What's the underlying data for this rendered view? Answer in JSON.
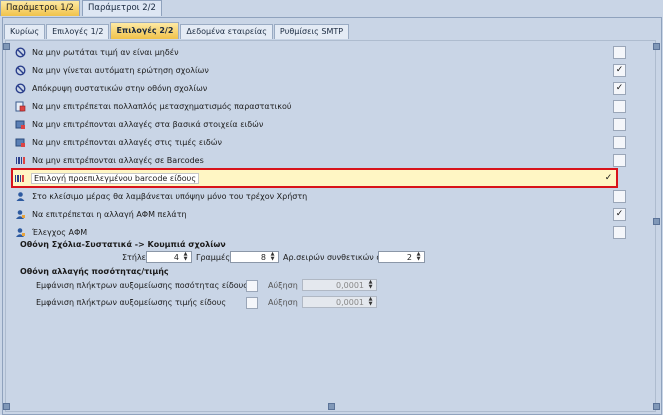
{
  "top_tabs": [
    "Παράμετροι 1/2",
    "Παράμετροι 2/2"
  ],
  "sub_tabs": [
    "Κυρίως",
    "Επιλογές 1/2",
    "Επιλογές 2/2",
    "Δεδομένα εταιρείας",
    "Ρυθμίσεις SMTP"
  ],
  "options": [
    {
      "label": "Να μην ρωτάται τιμή αν είναι μηδέν",
      "icon": "no-entry-icon",
      "checked": false
    },
    {
      "label": "Να μην γίνεται αυτόματη ερώτηση σχολίων",
      "icon": "no-entry-icon",
      "checked": true
    },
    {
      "label": "Απόκρυψη συστατικών στην οθόνη σχολίων",
      "icon": "no-entry-icon",
      "checked": true
    },
    {
      "label": "Να μην επιτρέπεται πολλαπλός μετασχηματισμός παραστατικού",
      "icon": "document-icon",
      "checked": false
    },
    {
      "label": "Να μην επιτρέπονται αλλαγές στα βασικά στοιχεία ειδών",
      "icon": "item-edit-icon",
      "checked": false
    },
    {
      "label": "Να μην επιτρέπονται αλλαγές στις τιμές ειδών",
      "icon": "item-edit-icon",
      "checked": false
    },
    {
      "label": "Να μην επιτρέπονται αλλαγές σε Barcodes",
      "icon": "barcode-icon",
      "checked": false
    },
    {
      "label": "Επιλογή προεπιλεγμένου barcode είδους",
      "icon": "barcode-icon",
      "checked": true
    },
    {
      "label": "Στο κλείσιμο μέρας θα λαμβάνεται υπόψην μόνο του τρέχον Χρήστη",
      "icon": "user-icon",
      "checked": false
    },
    {
      "label": "Να επιτρέπεται η αλλαγή ΑΦΜ πελάτη",
      "icon": "user-edit-icon",
      "checked": true
    },
    {
      "label": "Έλεγχος ΑΦΜ",
      "icon": "user-edit-icon",
      "checked": false
    }
  ],
  "comments_section": {
    "title": "Οθόνη Σχόλια-Συστατικά -> Κουμπιά σχολίων",
    "columns_label": "Στήλες",
    "columns_value": "4",
    "rows_label": "Γραμμές",
    "rows_value": "8",
    "component_rows_label": "Αρ.σειρών συνθετικών σχολίων",
    "component_rows_value": "2"
  },
  "quantity_section": {
    "title": "Οθόνη αλλαγής ποσότητας/τιμής",
    "qty_buttons_label": "Εμφάνιση πλήκτρων αυξομείωσης ποσότητας είδους",
    "qty_step_label": "Αύξηση",
    "qty_step_value": "0,0001",
    "price_buttons_label": "Εμφάνιση πλήκτρων αυξομείωσης τιμής είδους",
    "price_step_label": "Αύξηση",
    "price_step_value": "0,0001"
  }
}
